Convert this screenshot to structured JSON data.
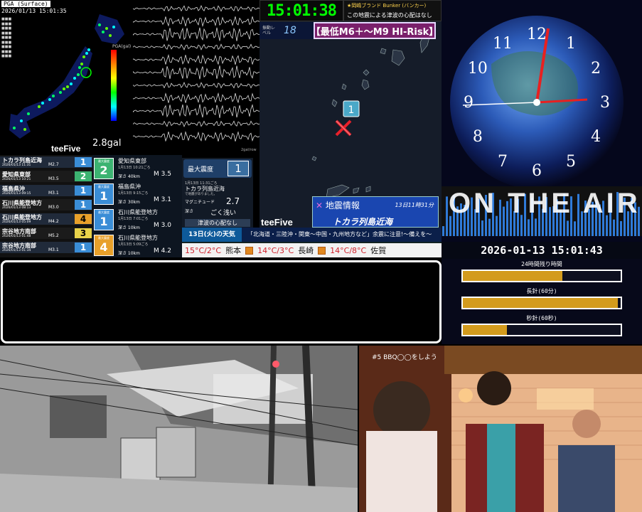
{
  "seismic_map": {
    "title": "PGA (Surface)",
    "timestamp": "2026/01/13 15:01:35",
    "pga_unit": "PGA(gal)",
    "min_label": "2.8gal",
    "value": "2.8gal",
    "brand": "teeFive"
  },
  "waveform": {
    "unit": "2gal/row"
  },
  "clock_banner": {
    "time": "15:01:38"
  },
  "bunker_banner": {
    "title": "★岡嶋ブランド Bunker (バンカー)",
    "subtitle": "この地震による津波の心配はなし"
  },
  "tsunami_map": {
    "level_label": "振動レベル",
    "level_value": "18",
    "risk_text": "【最低M6＋〜M9 HI-Risk】",
    "brand": "teeFive",
    "marker_intensity": "1",
    "quake_title": "地震情報",
    "quake_time": "13日11時31分",
    "quake_place": "トカラ列島近海"
  },
  "quake_list": [
    {
      "name": "トカラ列島近海",
      "date": "2026/01/13 11:31",
      "mag": "M2.7",
      "intensity": "1",
      "color": "#3a8dd6"
    },
    {
      "name": "愛知県東部",
      "date": "2026/01/13 10:21",
      "mag": "M3.5",
      "intensity": "2",
      "color": "#3cb371"
    },
    {
      "name": "福島県沖",
      "date": "2026/01/13 09:15",
      "mag": "M3.1",
      "intensity": "1",
      "color": "#3a8dd6"
    },
    {
      "name": "石川県能登地方",
      "date": "2026/01/13 08:13",
      "mag": "M3.0",
      "intensity": "1",
      "color": "#3a8dd6"
    },
    {
      "name": "石川県能登地方",
      "date": "2026/01/13 05:09",
      "mag": "M4.2",
      "intensity": "4",
      "color": "#e8a02a"
    },
    {
      "name": "宗谷地方南部",
      "date": "2026/01/13 01:48",
      "mag": "M5.2",
      "intensity": "3",
      "color": "#e8d24a"
    },
    {
      "name": "宗谷地方南部",
      "date": "2026/01/13 01:34",
      "mag": "M3.1",
      "intensity": "1",
      "color": "#3a8dd6"
    }
  ],
  "quake_cards": [
    {
      "int_label": "最大震度",
      "intensity": "2",
      "name": "愛知県東部",
      "time": "1月13日 10:21ごろ",
      "depth": "深さ 40km",
      "mag": "M 3.5",
      "color": "#3cb371"
    },
    {
      "int_label": "最大震度",
      "intensity": "1",
      "name": "福島県沖",
      "time": "1月13日 9:15ごろ",
      "depth": "深さ 30km",
      "mag": "M 3.1",
      "color": "#3a8dd6"
    },
    {
      "int_label": "最大震度",
      "intensity": "1",
      "name": "石川県能登地方",
      "time": "1月13日 7:01ごろ",
      "depth": "深さ 10km",
      "mag": "M 3.0",
      "color": "#3a8dd6"
    },
    {
      "int_label": "最大震度",
      "intensity": "4",
      "name": "石川県能登地方",
      "time": "1月13日 5:09ごろ",
      "depth": "深さ 10km",
      "mag": "M 4.2",
      "color": "#e8a02a"
    }
  ],
  "max_card": {
    "label": "最大震度",
    "value": "1",
    "date": "1月13日 11:31ごろ",
    "place": "トカラ列島近海",
    "depth_note": "で地震がありました。",
    "mag_label": "マグニチュード",
    "mag_value": "2.7",
    "depth_label": "深さ",
    "depth_value": "ごく浅い",
    "tsunami": "津波の心配なし"
  },
  "weather": {
    "head": "13日(火)の天気",
    "warning": "「北海道・三陸沖・関東〜中国・九州地方など」余震に注意!〜備えを〜",
    "cities": [
      {
        "city": "",
        "temp": "15°C/2°C"
      },
      {
        "city": "熊本",
        "temp": "14°C/3°C"
      },
      {
        "city": "長崎",
        "temp": "14°C/8°C"
      },
      {
        "city": "佐賀",
        "temp": ""
      }
    ]
  },
  "clock_panel": {
    "numbers": [
      "12",
      "1",
      "2",
      "3",
      "4",
      "5",
      "6",
      "7",
      "8",
      "9",
      "10",
      "11"
    ],
    "onair": "ON THE AIR",
    "datetime": "2026-01-13 15:01:43"
  },
  "progress": [
    {
      "label": "24時間残り時間",
      "fraction": 0.63
    },
    {
      "label": "長針(60分)",
      "fraction": 0.98
    },
    {
      "label": "秒針(60秒)",
      "fraction": 0.28
    }
  ],
  "cafe": {
    "caption": "#5 BBQ◯◯をしよう"
  },
  "colors": {
    "clock_green": "#00ff00",
    "risk_bg": "#7a1f6b",
    "quake_info_bg": "#1a46b0",
    "progress_fill": "#d39b1d"
  }
}
